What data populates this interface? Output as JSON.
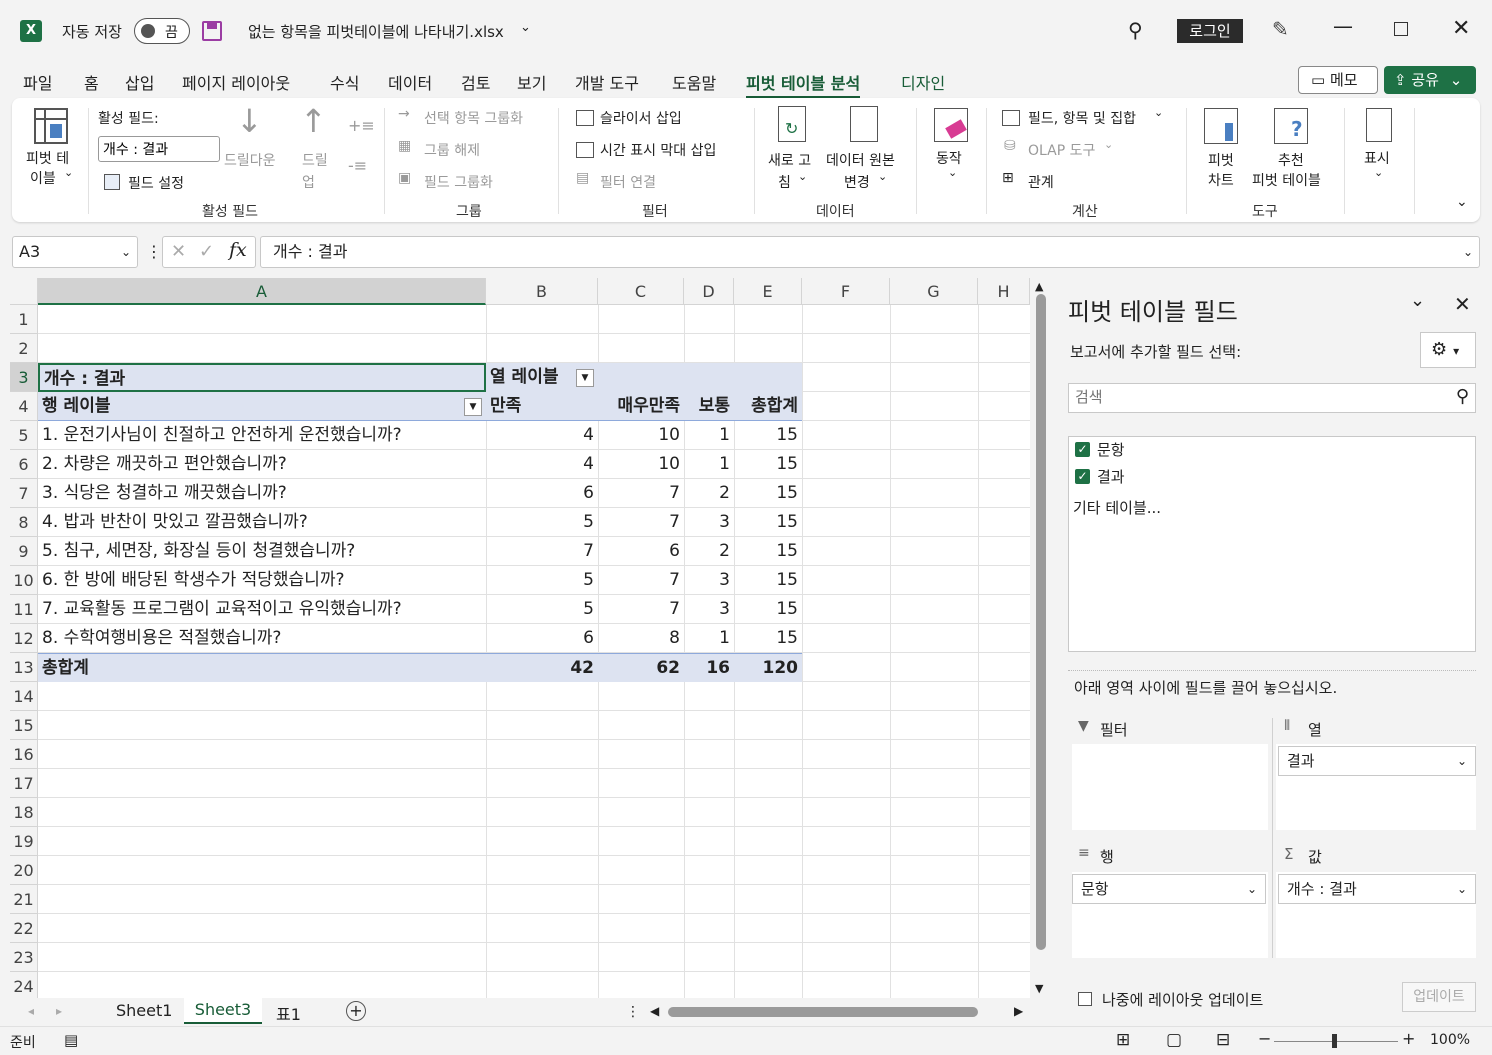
{
  "titlebar": {
    "autosave_label": "자동 저장",
    "autosave_state": "끔",
    "filename": "없는 항목을 피벗테이블에 나타내기.xlsx",
    "login_label": "로그인"
  },
  "tabs": [
    "파일",
    "홈",
    "삽입",
    "페이지 레이아웃",
    "수식",
    "데이터",
    "검토",
    "보기",
    "개발 도구",
    "도움말",
    "피벗 테이블 분석",
    "디자인"
  ],
  "active_tab": "피벗 테이블 분석",
  "memo_label": "메모",
  "share_label": "공유",
  "ribbon": {
    "pivot_table_label_1": "피벗 테",
    "pivot_table_label_2": "이블",
    "active_field_label": "활성 필드:",
    "active_field_value": "개수 : 결과",
    "field_settings": "필드 설정",
    "drill_down": "드릴다운",
    "drill_up_1": "드릴",
    "drill_up_2": "업",
    "active_field_group": "활성 필드",
    "group_selection": "선택 항목 그룹화",
    "ungroup": "그룹 해제",
    "group_field": "필드 그룹화",
    "group_group": "그룹",
    "insert_slicer": "슬라이서 삽입",
    "insert_timeline": "시간 표시 막대 삽입",
    "filter_connections": "필터 연결",
    "filter_group": "필터",
    "refresh_1": "새로 고",
    "refresh_2": "침",
    "change_source_1": "데이터 원본",
    "change_source_2": "변경",
    "data_group": "데이터",
    "actions": "동작",
    "fields_items_sets": "필드, 항목 및 집합",
    "olap_tools": "OLAP 도구",
    "relationships": "관계",
    "calc_group": "계산",
    "pivot_chart_1": "피벗",
    "pivot_chart_2": "차트",
    "recommended_1": "추천",
    "recommended_2": "피벗 테이블",
    "tools_group": "도구",
    "show": "표시"
  },
  "formula_bar": {
    "name_box": "A3",
    "formula": "개수 : 결과"
  },
  "columns": [
    "A",
    "B",
    "C",
    "D",
    "E",
    "F",
    "G",
    "H"
  ],
  "rows": [
    "1",
    "2",
    "3",
    "4",
    "5",
    "6",
    "7",
    "8",
    "9",
    "10",
    "11",
    "12",
    "13",
    "14",
    "15",
    "16",
    "17",
    "18",
    "19",
    "20",
    "21",
    "22",
    "23",
    "24"
  ],
  "pivot": {
    "value_label": "개수 : 결과",
    "col_labels": "열 레이블",
    "row_labels": "행 레이블",
    "headers": [
      "만족",
      "매우만족",
      "보통",
      "총합계"
    ],
    "data": [
      {
        "label": "1. 운전기사님이 친절하고 안전하게 운전했습니까?",
        "values": [
          "4",
          "10",
          "1",
          "15"
        ]
      },
      {
        "label": "2. 차량은 깨끗하고 편안했습니까?",
        "values": [
          "4",
          "10",
          "1",
          "15"
        ]
      },
      {
        "label": "3. 식당은 청결하고 깨끗했습니까?",
        "values": [
          "6",
          "7",
          "2",
          "15"
        ]
      },
      {
        "label": "4. 밥과 반찬이 맛있고 깔끔했습니까?",
        "values": [
          "5",
          "7",
          "3",
          "15"
        ]
      },
      {
        "label": "5. 침구, 세면장, 화장실 등이 청결했습니까?",
        "values": [
          "7",
          "6",
          "2",
          "15"
        ]
      },
      {
        "label": "6. 한 방에 배당된 학생수가 적당했습니까?",
        "values": [
          "5",
          "7",
          "3",
          "15"
        ]
      },
      {
        "label": "7. 교육활동 프로그램이 교육적이고 유익했습니까?",
        "values": [
          "5",
          "7",
          "3",
          "15"
        ]
      },
      {
        "label": "8. 수학여행비용은 적절했습니까?",
        "values": [
          "6",
          "8",
          "1",
          "15"
        ]
      }
    ],
    "total_label": "총합계",
    "totals": [
      "42",
      "62",
      "16",
      "120"
    ]
  },
  "field_pane": {
    "title": "피벗 테이블 필드",
    "subtitle": "보고서에 추가할 필드 선택:",
    "search_placeholder": "검색",
    "fields": [
      "문항",
      "결과"
    ],
    "more_tables": "기타 테이블...",
    "drag_hint": "아래 영역 사이에 필드를 끌어 놓으십시오.",
    "filter_area": "필터",
    "columns_area": "열",
    "rows_area": "행",
    "values_area": "값",
    "columns_item": "결과",
    "rows_item": "문항",
    "values_item": "개수 : 결과",
    "defer_label": "나중에 레이아웃 업데이트",
    "update_button": "업데이트"
  },
  "sheet_tabs": [
    "Sheet1",
    "Sheet3",
    "표1"
  ],
  "active_sheet": "Sheet3",
  "status": {
    "ready": "준비",
    "zoom": "100%"
  },
  "colors": {
    "excel_green": "#185c37",
    "pivot_highlight": "#dde3f1"
  }
}
